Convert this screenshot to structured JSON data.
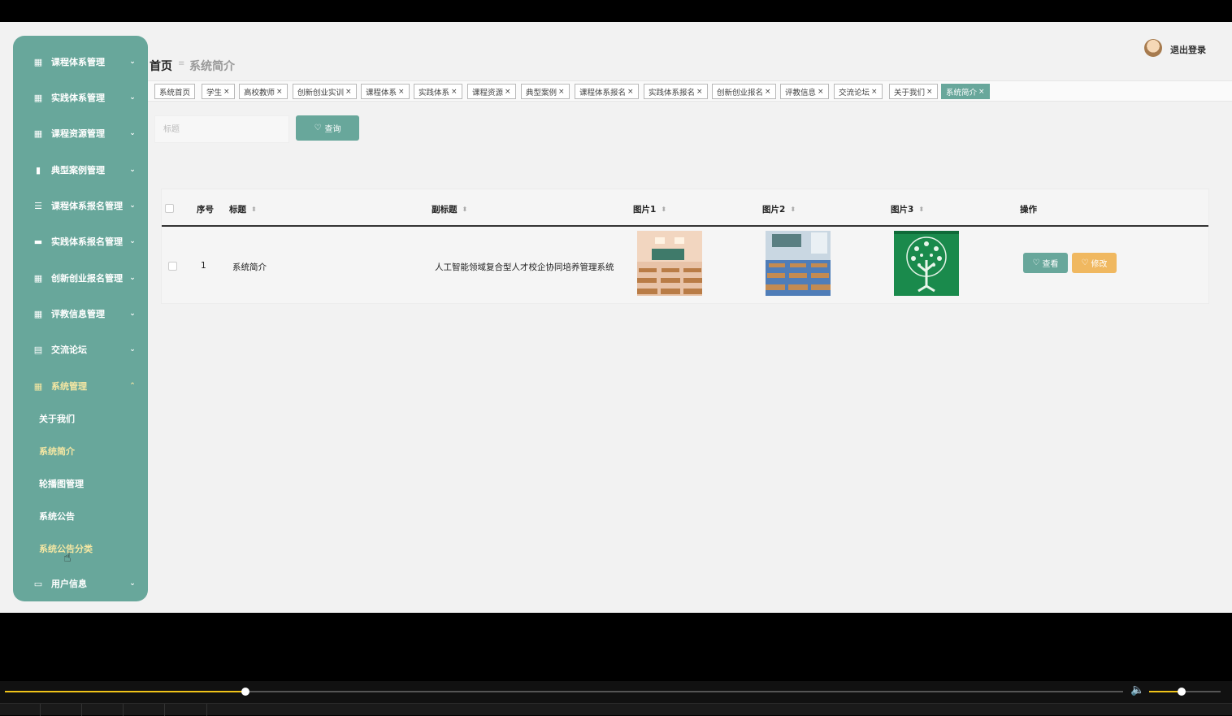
{
  "sidebar": {
    "items": [
      {
        "label": "课程体系管理",
        "icon": "grid-icon",
        "glyph": "▦",
        "arrow": "⌄"
      },
      {
        "label": "实践体系管理",
        "icon": "grid-icon",
        "glyph": "▦",
        "arrow": "⌄"
      },
      {
        "label": "课程资源管理",
        "icon": "grid-icon",
        "glyph": "▦",
        "arrow": "⌄"
      },
      {
        "label": "典型案例管理",
        "icon": "bar-chart-icon",
        "glyph": "▮",
        "arrow": "⌄"
      },
      {
        "label": "课程体系报名管理",
        "icon": "sliders-icon",
        "glyph": "☰",
        "arrow": "⌄"
      },
      {
        "label": "实践体系报名管理",
        "icon": "message-icon",
        "glyph": "▬",
        "arrow": "⌄"
      },
      {
        "label": "创新创业报名管理",
        "icon": "grid-icon",
        "glyph": "▦",
        "arrow": "⌄"
      },
      {
        "label": "评教信息管理",
        "icon": "grid-icon",
        "glyph": "▦",
        "arrow": "⌄"
      },
      {
        "label": "交流论坛",
        "icon": "clipboard-icon",
        "glyph": "▤",
        "arrow": "⌄"
      },
      {
        "label": "系统管理",
        "icon": "grid-icon",
        "glyph": "▦",
        "arrow": "⌃"
      }
    ],
    "sub_items": [
      {
        "label": "关于我们"
      },
      {
        "label": "系统简介"
      },
      {
        "label": "轮播图管理"
      },
      {
        "label": "系统公告"
      },
      {
        "label": "系统公告分类"
      }
    ],
    "user_item": {
      "label": "用户信息",
      "icon": "id-card-icon",
      "glyph": "▭",
      "arrow": "⌄"
    }
  },
  "header": {
    "breadcrumb_home": "首页",
    "breadcrumb_sep": "≡",
    "breadcrumb_current": "系统简介",
    "logout": "退出登录"
  },
  "tabs": [
    {
      "label": "系统首页",
      "closable": false
    },
    {
      "label": "学生",
      "closable": true
    },
    {
      "label": "高校教师",
      "closable": true
    },
    {
      "label": "创新创业实训",
      "closable": true
    },
    {
      "label": "课程体系",
      "closable": true
    },
    {
      "label": "实践体系",
      "closable": true
    },
    {
      "label": "课程资源",
      "closable": true
    },
    {
      "label": "典型案例",
      "closable": true
    },
    {
      "label": "课程体系报名",
      "closable": true
    },
    {
      "label": "实践体系报名",
      "closable": true
    },
    {
      "label": "创新创业报名",
      "closable": true
    },
    {
      "label": "评教信息",
      "closable": true
    },
    {
      "label": "交流论坛",
      "closable": true
    },
    {
      "label": "关于我们",
      "closable": true
    },
    {
      "label": "系统简介",
      "closable": true,
      "active": true
    }
  ],
  "search": {
    "placeholder": "标题",
    "button_label": "查询",
    "button_icon": "♡"
  },
  "table": {
    "columns": [
      "序号",
      "标题",
      "副标题",
      "图片1",
      "图片2",
      "图片3",
      "操作"
    ],
    "rows": [
      {
        "index": "1",
        "title": "系统简介",
        "subtitle": "人工智能领域复合型人才校企协同培养管理系统",
        "images": [
          "classroom-image",
          "classroom-blue-image",
          "tree-image"
        ]
      }
    ],
    "view_label": "查看",
    "edit_label": "修改",
    "action_icon": "♡"
  },
  "player": {
    "progress": 0.215,
    "volume": 0.45
  },
  "colors": {
    "accent": "#68a79b",
    "edit": "#f0b860",
    "active_text": "#f5e7a3"
  }
}
